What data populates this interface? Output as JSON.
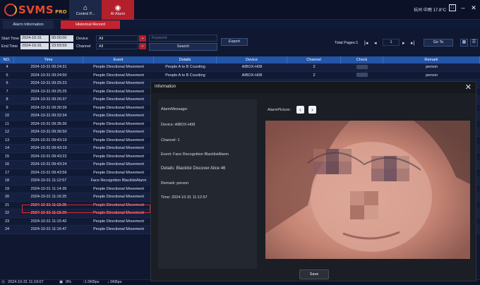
{
  "app": {
    "logo_text": "SVMS",
    "logo_suffix": "PRO"
  },
  "topnav": [
    {
      "label": "Control P...",
      "icon": "home-icon",
      "active": false
    },
    {
      "label": "AI Alarm",
      "icon": "alarm-icon",
      "active": true
    }
  ],
  "weather": "杭州 中雨 17.8°C",
  "tabs": [
    {
      "label": "Alarm Information",
      "active": false
    },
    {
      "label": "Historical Record",
      "active": true
    }
  ],
  "filters": {
    "start_time_label": "Start Time",
    "start_date": "2024-10-31",
    "start_time": "00:00:00",
    "end_time_label": "End Time",
    "end_date": "2024-10-31",
    "end_time": "23:59:59",
    "device_label": "Device",
    "device_value": "All",
    "channel_label": "Channel",
    "channel_value": "All",
    "keyword_placeholder": "Keyword",
    "search_label": "Search",
    "export_label": "Export"
  },
  "pager": {
    "total_pages": "Total Pages:1",
    "page": "1",
    "goto_label": "Go To"
  },
  "table": {
    "headers": [
      "NO.",
      "Time",
      "Event",
      "Details",
      "Device",
      "Channel",
      "Check",
      "Remark"
    ],
    "rows": [
      {
        "no": "4",
        "time": "2024-10-31 09:24:31",
        "event": "People Directional Movement",
        "details": "People A to B Counting",
        "device": "AIBOX-H08",
        "channel": "2",
        "remark": "person"
      },
      {
        "no": "5",
        "time": "2024-10-31 09:24:50",
        "event": "People Directional Movement",
        "details": "People A to B Counting",
        "device": "AIBOX-H08",
        "channel": "2",
        "remark": "person"
      },
      {
        "no": "6",
        "time": "2024-10-31 09:25:23",
        "event": "People Directional Movement",
        "details": "",
        "device": "",
        "channel": "",
        "remark": ""
      },
      {
        "no": "7",
        "time": "2024-10-31 09:25:25",
        "event": "People Directional Movement",
        "details": "",
        "device": "",
        "channel": "",
        "remark": ""
      },
      {
        "no": "8",
        "time": "2024-10-31 09:26:37",
        "event": "People Directional Movement",
        "details": "",
        "device": "",
        "channel": "",
        "remark": ""
      },
      {
        "no": "9",
        "time": "2024-10-31 09:30:39",
        "event": "People Directional Movement",
        "details": "",
        "device": "",
        "channel": "",
        "remark": ""
      },
      {
        "no": "10",
        "time": "2024-10-31 09:32:34",
        "event": "People Directional Movement",
        "details": "",
        "device": "",
        "channel": "",
        "remark": ""
      },
      {
        "no": "11",
        "time": "2024-10-31 09:35:36",
        "event": "People Directional Movement",
        "details": "",
        "device": "",
        "channel": "",
        "remark": ""
      },
      {
        "no": "12",
        "time": "2024-10-31 09:36:50",
        "event": "People Directional Movement",
        "details": "",
        "device": "",
        "channel": "",
        "remark": ""
      },
      {
        "no": "13",
        "time": "2024-10-31 09:43:19",
        "event": "People Directional Movement",
        "details": "",
        "device": "",
        "channel": "",
        "remark": ""
      },
      {
        "no": "14",
        "time": "2024-10-31 09:43:19",
        "event": "People Directional Movement",
        "details": "",
        "device": "",
        "channel": "",
        "remark": ""
      },
      {
        "no": "15",
        "time": "2024-10-31 09:43:22",
        "event": "People Directional Movement",
        "details": "",
        "device": "",
        "channel": "",
        "remark": ""
      },
      {
        "no": "16",
        "time": "2024-10-31 09:43:24",
        "event": "People Directional Movement",
        "details": "",
        "device": "",
        "channel": "",
        "remark": ""
      },
      {
        "no": "17",
        "time": "2024-10-31 09:43:56",
        "event": "People Directional Movement",
        "details": "",
        "device": "",
        "channel": "",
        "remark": ""
      },
      {
        "no": "18",
        "time": "2024-10-31 11:12:57",
        "event": "Face Recognition BlacklistAlarm",
        "details": "",
        "device": "",
        "channel": "",
        "remark": ""
      },
      {
        "no": "19",
        "time": "2024-10-31 11:14:39",
        "event": "People Directional Movement",
        "details": "",
        "device": "",
        "channel": "",
        "remark": ""
      },
      {
        "no": "20",
        "time": "2024-10-31 11:16:25",
        "event": "People Directional Movement",
        "details": "",
        "device": "",
        "channel": "",
        "remark": ""
      },
      {
        "no": "21",
        "time": "2024-10-31 11:15:25",
        "event": "People Directional Movement",
        "details": "",
        "device": "",
        "channel": "",
        "remark": ""
      },
      {
        "no": "22",
        "time": "2024-10-31 11:15:29",
        "event": "People Directional Movement",
        "details": "",
        "device": "",
        "channel": "",
        "remark": ""
      },
      {
        "no": "23",
        "time": "2024-10-31 11:15:42",
        "event": "People Directional Movement",
        "details": "",
        "device": "",
        "channel": "",
        "remark": ""
      },
      {
        "no": "24",
        "time": "2024-10-31 11:16:47",
        "event": "People Directional Movement",
        "details": "",
        "device": "",
        "channel": "",
        "remark": ""
      }
    ]
  },
  "status": {
    "datetime": "2024-10-31 11:19:07",
    "cpu": "9%",
    "up": "↑1.0KBps",
    "down": "↓ 0KBps"
  },
  "modal": {
    "title": "Information",
    "alarm_message_label": "AlarmMessage:",
    "device": "Device: AIBOX-H08",
    "channel": "Channel: 1",
    "event": "Event: Face Recognition BlacklistAlarm",
    "details": "Details:  Blacklist Discover Alice 46",
    "remark": "Remark: person",
    "time": "Time: 2024-10-31 11:12:57",
    "alarm_picture_label": "AlarmPicture:",
    "save_label": "Save"
  },
  "colors": {
    "accent_red": "#b3202c",
    "header_blue": "#2355a8",
    "highlight": "#e0282f"
  }
}
